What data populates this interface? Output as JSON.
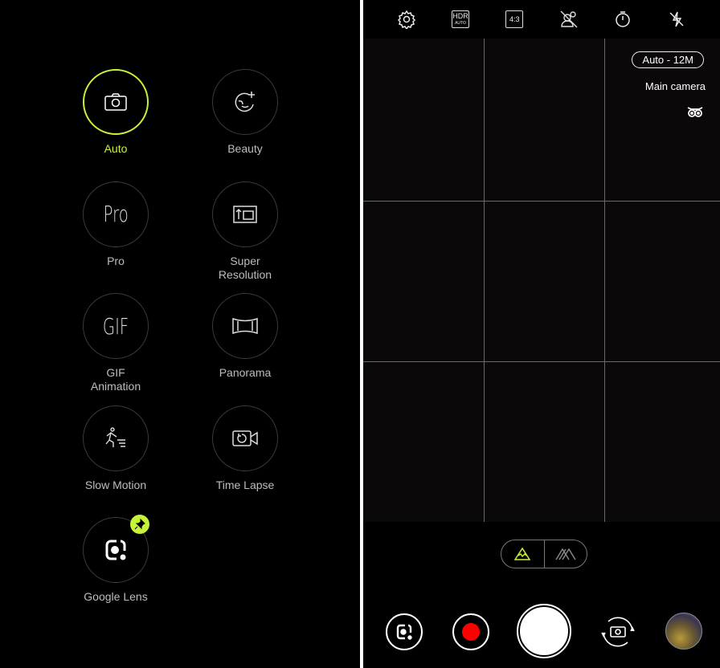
{
  "modes": [
    {
      "label": "Auto",
      "icon": "camera-icon",
      "active": true
    },
    {
      "label": "Beauty",
      "icon": "beauty-icon"
    },
    {
      "label": "Pro",
      "icon": "pro-text-icon",
      "glyph": "Pro"
    },
    {
      "label": "Super Resolution",
      "icon": "super-resolution-icon"
    },
    {
      "label": "GIF Animation",
      "icon": "gif-text-icon",
      "glyph": "GIF"
    },
    {
      "label": "Panorama",
      "icon": "panorama-icon"
    },
    {
      "label": "Slow Motion",
      "icon": "slow-motion-icon"
    },
    {
      "label": "Time Lapse",
      "icon": "time-lapse-icon"
    },
    {
      "label": "Google Lens",
      "icon": "google-lens-icon",
      "pinned": true
    }
  ],
  "topbar": {
    "hdr": "HDR",
    "hdr_sub": "AUTO",
    "ratio": "4:3",
    "icons": [
      "gear-icon",
      "hdr-auto-icon",
      "aspect-ratio-icon",
      "portrait-off-icon",
      "timer-icon",
      "flash-off-icon"
    ]
  },
  "viewfinder": {
    "resolution": "Auto - 12M",
    "camera": "Main camera"
  },
  "colors": {
    "accent": "#c6f238",
    "record": "#ff0000"
  }
}
